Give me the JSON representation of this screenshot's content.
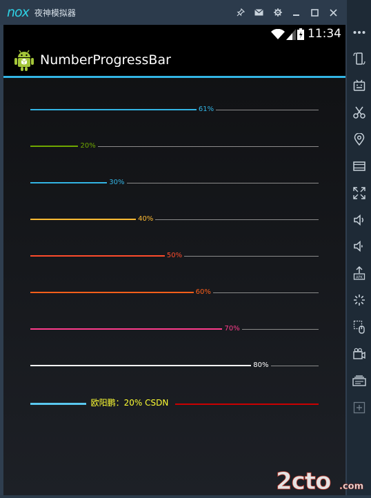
{
  "window": {
    "logo": "nox",
    "title": "夜神模拟器",
    "controls": [
      "pin-icon",
      "envelope-icon",
      "gear-icon",
      "minimize-icon",
      "maximize-icon",
      "close-icon"
    ]
  },
  "status_bar": {
    "time": "11:34"
  },
  "action_bar": {
    "title": "NumberProgressBar"
  },
  "progress_bars": [
    {
      "label": "61%",
      "progress": 61,
      "color": "#33b5e5"
    },
    {
      "label": "20%",
      "progress": 20,
      "color": "#70a800"
    },
    {
      "label": "30%",
      "progress": 30,
      "color": "#33b5e5"
    },
    {
      "label": "40%",
      "progress": 40,
      "color": "#ffbb33"
    },
    {
      "label": "50%",
      "progress": 50,
      "color": "#ff4c2c"
    },
    {
      "label": "60%",
      "progress": 60,
      "color": "#ff5f1a"
    },
    {
      "label": "70%",
      "progress": 70,
      "color": "#ff3c8c"
    },
    {
      "label": "80%",
      "progress": 80,
      "color": "#ffffff"
    }
  ],
  "custom_bar": {
    "label": "欧阳鹏：20%  CSDN",
    "progress": 20,
    "reached_color": "#5ac8f0",
    "unreached_color": "#cc0000",
    "text_color": "#ffff33"
  },
  "sidebar": [
    "more-icon",
    "phone-rotate-icon",
    "keyboard-icon",
    "scissors-icon",
    "location-icon",
    "screen-icon",
    "fullscreen-icon",
    "volume-up-icon",
    "volume-down-icon",
    "apk-install-icon",
    "shake-icon",
    "macro-icon",
    "video-record-icon",
    "multi-instance-icon",
    "add-icon"
  ],
  "watermark": {
    "brand": "2cto",
    "suffix": ".com"
  }
}
